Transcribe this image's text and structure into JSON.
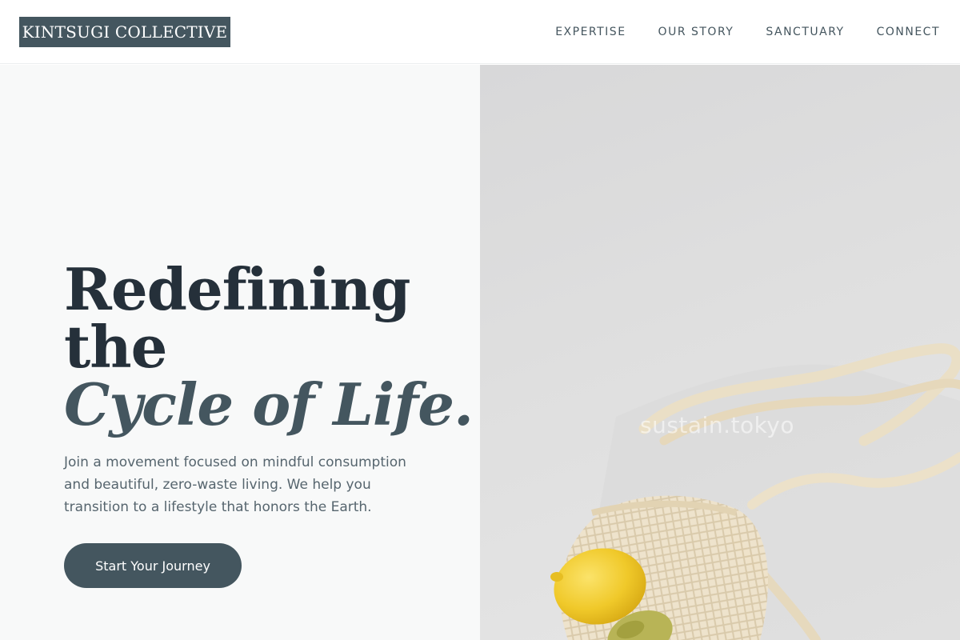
{
  "brand": {
    "name": "KINTSUGI COLLECTIVE"
  },
  "nav": {
    "items": [
      {
        "label": "EXPERTISE"
      },
      {
        "label": "OUR STORY"
      },
      {
        "label": "SANCTUARY"
      },
      {
        "label": "CONNECT"
      }
    ]
  },
  "hero": {
    "headline_line1": "Redefining",
    "headline_line2": "the",
    "headline_accent": "Cycle of Life.",
    "description": "Join a movement focused on mindful consumption and beautiful, zero-waste living. We help you transition to a lifestyle that honors the Earth.",
    "cta_label": "Start Your Journey",
    "image_watermark": "sustain.tokyo"
  },
  "colors": {
    "primary": "#44565f",
    "heading": "#25303a",
    "body_text": "#56656e",
    "left_panel_bg": "#f8f9f9",
    "lemon": "#f2cc2a",
    "bag": "#ece0c8"
  },
  "icons": {
    "hero_image": "mesh-bag-with-lemon-photo"
  }
}
